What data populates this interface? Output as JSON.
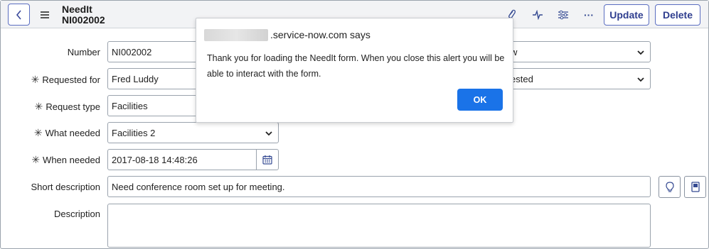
{
  "header": {
    "title": "NeedIt",
    "record": "NI002002",
    "update_label": "Update",
    "delete_label": "Delete"
  },
  "form": {
    "number": {
      "label": "Number",
      "value": "NI002002"
    },
    "requested_for": {
      "label": "Requested for",
      "value": "Fred Luddy"
    },
    "request_type": {
      "label": "Request type",
      "value": "Facilities"
    },
    "what_needed": {
      "label": "What needed",
      "value": "Facilities 2"
    },
    "when_needed": {
      "label": "When needed",
      "value": "2017-08-18 14:48:26"
    },
    "short_description": {
      "label": "Short description",
      "value": "Need conference room set up for meeting."
    },
    "description": {
      "label": "Description",
      "value": ""
    },
    "right_col_1_partial": "w",
    "right_col_2_partial": "ested"
  },
  "dialog": {
    "title": ".service-now.com says",
    "message": "Thank you for loading the NeedIt form.   When you close this alert you will be able to interact with the form.",
    "ok_label": "OK"
  },
  "colors": {
    "accent": "#2f3e8f",
    "ok_button": "#1a73e8",
    "header_bg": "#f2f3f5"
  }
}
